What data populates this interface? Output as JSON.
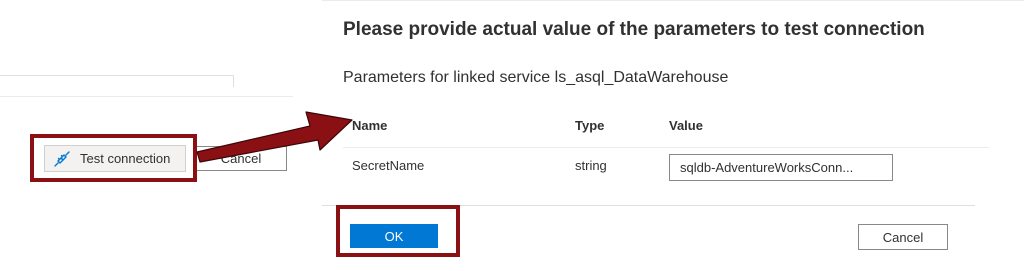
{
  "left_pane": {
    "test_connection_label": "Test connection",
    "test_connection_icon": "plug-connection-icon",
    "cancel_label": "Cancel"
  },
  "dialog": {
    "title": "Please provide actual value of the parameters to test connection",
    "subtitle": "Parameters for linked service ls_asql_DataWarehouse",
    "columns": [
      "Name",
      "Type",
      "Value"
    ],
    "rows": [
      {
        "name": "SecretName",
        "type": "string",
        "value": "sqldb-AdventureWorksConn..."
      }
    ],
    "ok_label": "OK",
    "cancel_label": "Cancel"
  },
  "colors": {
    "accent": "#0078d4",
    "annotation": "#8b1014",
    "icon": "#0078d4"
  }
}
